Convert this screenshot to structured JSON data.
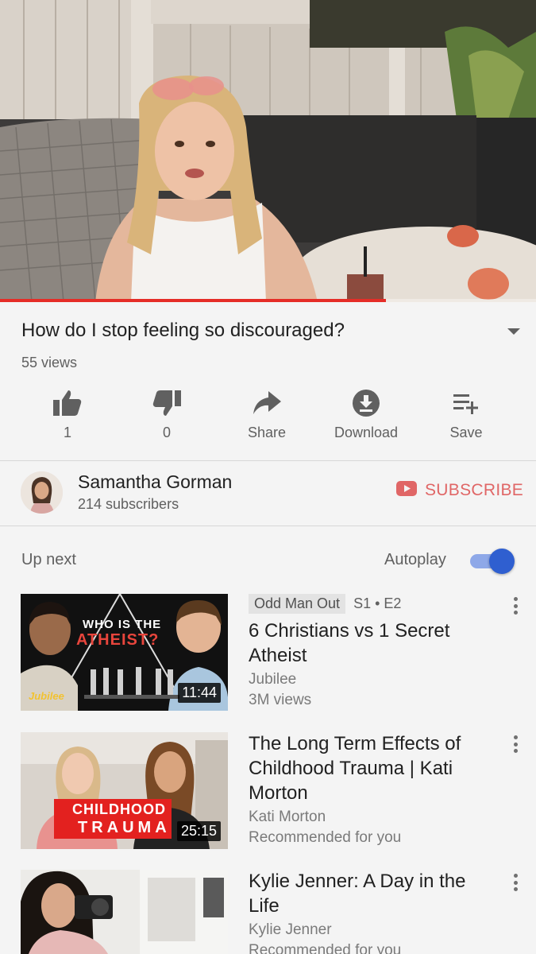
{
  "player": {
    "progress_fraction": 0.72
  },
  "video": {
    "title": "How do I stop feeling so discouraged?",
    "views": "55 views",
    "expand_icon": "caret-down-icon"
  },
  "actions": [
    {
      "name": "like",
      "icon": "thumbs-up-icon",
      "label": "1"
    },
    {
      "name": "dislike",
      "icon": "thumbs-down-icon",
      "label": "0"
    },
    {
      "name": "share",
      "icon": "share-arrow-icon",
      "label": "Share"
    },
    {
      "name": "download",
      "icon": "download-circle-icon",
      "label": "Download"
    },
    {
      "name": "save",
      "icon": "playlist-add-icon",
      "label": "Save"
    }
  ],
  "channel": {
    "name": "Samantha Gorman",
    "subscribers": "214 subscribers",
    "subscribe_label": "SUBSCRIBE",
    "subscribe_color": "#e06666"
  },
  "upnext": {
    "label": "Up next",
    "autoplay_label": "Autoplay",
    "autoplay_on": true,
    "accent": "#2f5fd0"
  },
  "videos": [
    {
      "badge": "Odd Man Out",
      "episode": "S1 • E2",
      "title": "6 Christians vs 1 Secret Atheist",
      "channel": "Jubilee",
      "info": "3M views",
      "duration": "11:44",
      "thumb_text_1": "WHO IS THE",
      "thumb_text_2": "ATHEIST?",
      "thumb_logo": "Jubilee"
    },
    {
      "title": "The Long Term Effects of Childhood Trauma | Kati Morton",
      "channel": "Kati Morton",
      "info": "Recommended for you",
      "duration": "25:15",
      "thumb_text_1": "CHILDHOOD",
      "thumb_text_2": "TRAUMA"
    },
    {
      "title": "Kylie Jenner: A Day in the Life",
      "channel": "Kylie Jenner",
      "info": "Recommended for you"
    }
  ]
}
